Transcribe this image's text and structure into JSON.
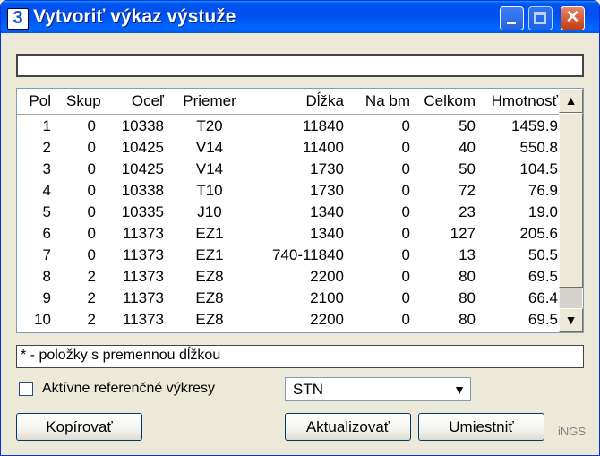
{
  "window": {
    "title": "Vytvoriť výkaz výstuže",
    "icon_letter": "3"
  },
  "top_input": {
    "value": ""
  },
  "table": {
    "headers": [
      "Pol",
      "Skup",
      "Oceľ",
      "Priemer",
      "Dĺžka",
      "Na bm",
      "Celkom",
      "Hmotnosť"
    ],
    "rows": [
      [
        "1",
        "0",
        "10338",
        "T20",
        "11840",
        "0",
        "50",
        "1459.9"
      ],
      [
        "2",
        "0",
        "10425",
        "V14",
        "11400",
        "0",
        "40",
        "550.8"
      ],
      [
        "3",
        "0",
        "10425",
        "V14",
        "1730",
        "0",
        "50",
        "104.5"
      ],
      [
        "4",
        "0",
        "10338",
        "T10",
        "1730",
        "0",
        "72",
        "76.9"
      ],
      [
        "5",
        "0",
        "10335",
        "J10",
        "1340",
        "0",
        "23",
        "19.0"
      ],
      [
        "6",
        "0",
        "11373",
        "EZ1",
        "1340",
        "0",
        "127",
        "205.6"
      ],
      [
        "7",
        "0",
        "11373",
        "EZ1",
        "740-11840",
        "0",
        "13",
        "50.5"
      ],
      [
        "8",
        "2",
        "11373",
        "EZ8",
        "2200",
        "0",
        "80",
        "69.5"
      ],
      [
        "9",
        "2",
        "11373",
        "EZ8",
        "2100",
        "0",
        "80",
        "66.4"
      ],
      [
        "10",
        "2",
        "11373",
        "EZ8",
        "2200",
        "0",
        "80",
        "69.5"
      ]
    ]
  },
  "note": {
    "text": "* - položky s premennou dĺžkou"
  },
  "checkbox": {
    "label": "Aktívne referenčné výkresy",
    "checked": false
  },
  "select": {
    "value": "STN"
  },
  "buttons": {
    "copy": "Kopírovať",
    "update": "Aktualizovať",
    "place": "Umiestniť"
  },
  "brand": "iNGS",
  "icons": {
    "up": "▲",
    "down": "▼",
    "dropdown": "▼",
    "close": "✕"
  }
}
